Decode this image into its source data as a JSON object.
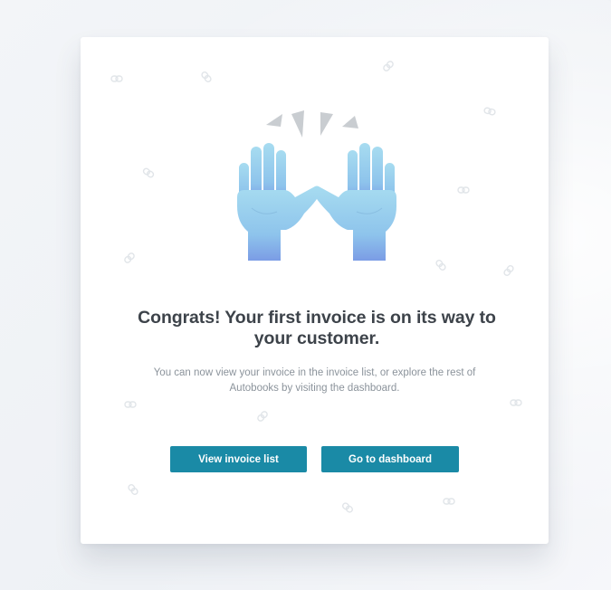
{
  "modal": {
    "title": "Congrats! Your first invoice is on its way to your customer.",
    "description": "You can now view your invoice in the invoice list, or explore the rest of Autobooks by visiting the dashboard.",
    "illustration_icon": "raised-hands-icon",
    "decoration_icon": "link-chain-icon"
  },
  "actions": {
    "view_invoice_list_label": "View invoice list",
    "go_to_dashboard_label": "Go to dashboard"
  },
  "colors": {
    "button_bg": "#1a8aa6",
    "title_text": "#3d434a",
    "body_text": "#8b939b",
    "hand_light": "#9fd3ee",
    "hand_dark": "#7aa0e6",
    "spark": "#c9cdd1"
  }
}
